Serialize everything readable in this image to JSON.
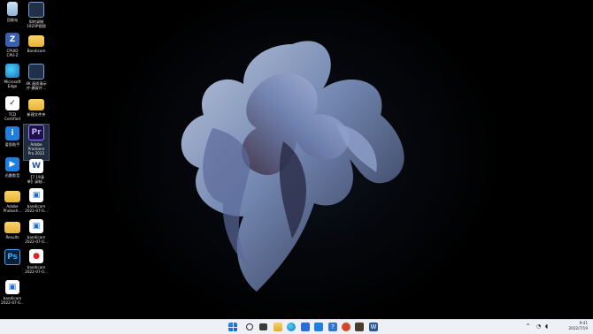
{
  "desktop": {
    "icons": [
      {
        "label": "回收站",
        "icon": "recycle-bin-icon"
      },
      {
        "label": "如何录制\n1920P视频",
        "icon": "video-file-icon"
      },
      {
        "label": "CPUID\nCPU-Z",
        "icon": "cpuz-icon"
      },
      {
        "label": "Bandicam",
        "icon": "folder-icon"
      },
      {
        "label": "Microsoft\nEdge",
        "icon": "edge-icon"
      },
      {
        "label": "4K 画质演示\n片-横屏片...",
        "icon": "video-file-icon"
      },
      {
        "label": "TCD\nCertified",
        "icon": "tcd-icon"
      },
      {
        "label": "新建文件夹",
        "icon": "folder-icon"
      },
      {
        "label": "爱思助手",
        "icon": "app-icon"
      },
      {
        "label": "Adobe\nPremiere\nPro 2022",
        "icon": "premiere-icon"
      },
      {
        "label": "迅雷影音",
        "icon": "app-icon"
      },
      {
        "label": "【7.19清\n单】录制...",
        "icon": "word-doc-icon"
      },
      {
        "label": "Adobe\nPhotosh...",
        "icon": "folder-icon"
      },
      {
        "label": "bandicam\n2022-07-0...",
        "icon": "bandicam-file-icon"
      },
      {
        "label": "Results",
        "icon": "folder-icon"
      },
      {
        "label": "bandicam\n2022-07-0...",
        "icon": "bandicam-file-icon"
      },
      {
        "label": "Ps",
        "icon": "photoshop-icon"
      },
      {
        "label": "bandicam\n2022-07-0...",
        "icon": "bandicam-app-icon"
      },
      {
        "label": "bandicam\n2022-07-0...",
        "icon": "bandicam-file-icon"
      }
    ],
    "selected_icon": "Adobe Premiere Pro 2022"
  },
  "taskbar": {
    "icons": [
      "start-icon",
      "search-icon",
      "task-view-icon",
      "file-explorer-icon",
      "edge-icon",
      "store-icon",
      "app-icon",
      "app-icon",
      "app-icon",
      "app-icon",
      "app-icon",
      "word-icon"
    ],
    "tray": {
      "chevron": "^",
      "network": "◔",
      "volume": "◖"
    },
    "clock": {
      "time": "9:41",
      "date": "2022/7/19"
    }
  },
  "colors": {
    "accent": "#1e7fe0",
    "taskbar_bg": "#eef0f5"
  }
}
